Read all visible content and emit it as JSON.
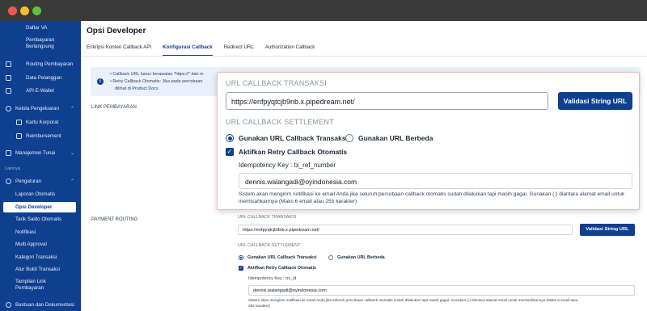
{
  "sidebar": {
    "items": [
      {
        "label": "Daftar VA",
        "icon": "",
        "active": false
      },
      {
        "label": "Pembayaran Berlangsung",
        "icon": "",
        "active": false
      },
      {
        "label": "Routing Pembayaran",
        "icon": "routing-icon",
        "active": false
      },
      {
        "label": "Data Pelanggan",
        "icon": "customer-icon",
        "active": false
      },
      {
        "label": "API E-Wallet",
        "icon": "wallet-icon",
        "active": false
      },
      {
        "label": "Kelola Pengeluaran",
        "icon": "expense-icon",
        "active": false
      },
      {
        "label": "Kartu Korporat",
        "icon": "card-icon",
        "active": false
      },
      {
        "label": "Reimbursement",
        "icon": "reimbursement-icon",
        "active": false
      },
      {
        "label": "Manajemen Tunai",
        "icon": "cash-icon",
        "active": false
      },
      {
        "label": "Pengaturan",
        "icon": "settings-icon",
        "active": false
      },
      {
        "label": "Laporan Otomatis",
        "icon": "",
        "active": false
      },
      {
        "label": "Opsi Developer",
        "icon": "",
        "active": true
      },
      {
        "label": "Tarik Saldo Otomatis",
        "icon": "",
        "active": false
      },
      {
        "label": "Notifikasi",
        "icon": "",
        "active": false
      },
      {
        "label": "Multi Approval",
        "icon": "",
        "active": false
      },
      {
        "label": "Kategori Transaksi",
        "icon": "",
        "active": false
      },
      {
        "label": "Atur Bukti Transaksi",
        "icon": "",
        "active": false
      },
      {
        "label": "Tampilan Link Pembayaran",
        "icon": "",
        "active": false
      },
      {
        "label": "Bantuan dan Dokumentasi",
        "icon": "help-icon",
        "active": false
      }
    ],
    "section_label": "Lainnya"
  },
  "header": {
    "title": "Opsi Developer"
  },
  "tabs": [
    {
      "label": "Enkripsi Konten Callback API",
      "active": false
    },
    {
      "label": "Konfigurasi Callback",
      "active": true
    },
    {
      "label": "Redirect URL",
      "active": false
    },
    {
      "label": "Authorization Callback",
      "active": false
    }
  ],
  "info": {
    "line1": "• Callback URL harus berawalan \"https://\" dan m",
    "line2": "• Retry Callback Otomatis: Jika pada percobaan",
    "line3": "dilihat di",
    "link": "Product Docs"
  },
  "sections": {
    "link_pembayaran": "LINK PEMBAYARAN",
    "payment_routing": "PAYMENT ROUTING"
  },
  "popup": {
    "title_transaksi": "URL CALLBACK TRANSAKSI",
    "url_value": "https://enfpyqtcjb9nb.x.pipedream.net/",
    "validate_label": "Validasi String URL",
    "title_settlement": "URL CALLBACK SETTLEMENT",
    "radio_same": "Gunakan URL Callback Transaksi",
    "radio_diff": "Gunakan URL Berbeda",
    "checkbox_retry": "Aktifkan Retry Callback Otomatis",
    "idempotency": "Idempotency Key : tx_ref_number",
    "email_value": "dennis.walangadi@oyindonesia.com",
    "help_text": "Sistem akan mengirim notifikasi ke email Anda jika seluruh percobaan callback otomatis sudah dilakukan tapi masih gagal. Gunakan (;) diantara alamat email untuk memisahkannya (Maks 6 email atau 255 karakter)"
  },
  "lower": {
    "title_transaksi": "URL CALLBACK TRANSAKSI",
    "url_value": "https://enfpyqtcjb9nb.x.pipedream.net/",
    "validate_label": "Validasi String URL",
    "title_settlement": "URL CALLBACK SETTLEMENT",
    "radio_same": "Gunakan URL Callback Transaksi",
    "radio_diff": "Gunakan URL Berbeda",
    "checkbox_retry": "Aktifkan Retry Callback Otomatis",
    "idempotency": "Idempotency Key : trx_id",
    "email_value": "dennis.walangadi@oyindonesia.com",
    "help_text_1": "Sistem akan mengirim notifikasi ke email Anda jika seluruh percobaan callback otomatis sudah dilakukan tapi masih gagal. Gunakan (;) diantara alamat email untuk memisahkannya (Maks 6 email atau",
    "help_text_2": "255 karakter)"
  },
  "colors": {
    "brand": "#0f3f8f",
    "sidebar_bg": "#0f3f8f",
    "chrome": "#3a3a3a"
  }
}
